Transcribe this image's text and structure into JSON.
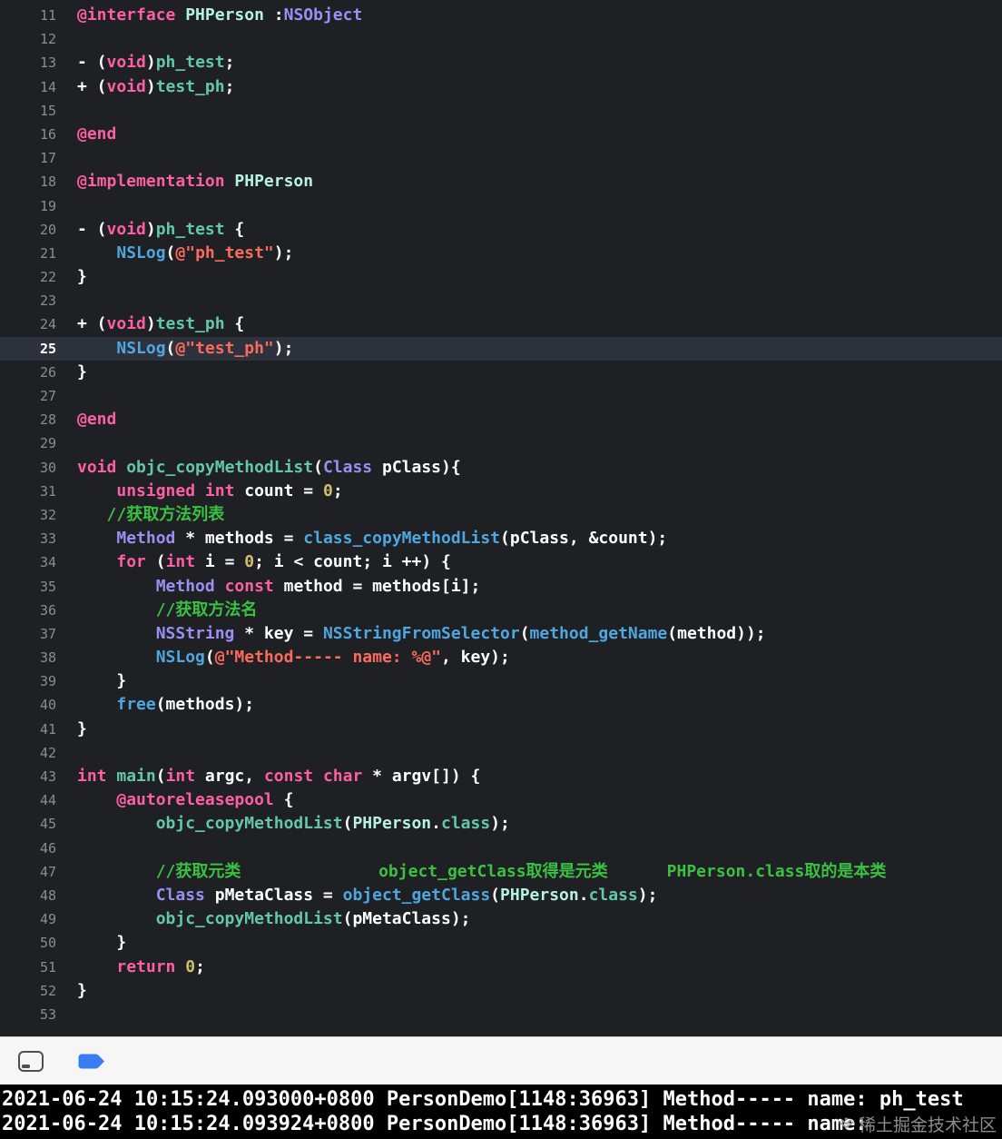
{
  "palette": {
    "editor-bg": "#1e2024",
    "hl-row": "#2e323c",
    "gutter": "#8c8d92",
    "c-kw": "#fc5fa3",
    "c-pl": "#ffffff",
    "c-tc": "#b5f2e1",
    "c-ts": "#9e8df2",
    "c-fn": "#63c7a9",
    "c-fs": "#4ea7e0",
    "c-st": "#fc6a5d",
    "c-nm": "#d0bf69",
    "c-cm": "#3bc142",
    "bar-bg": "#f6f6f6",
    "bar-border": "#c9c9c9",
    "icon-gray": "#4f4f52",
    "breakpoint": "#3a7cf2",
    "console-bg": "#000000",
    "console-fg": "#ffffff",
    "watermark": "#9a9a9a"
  },
  "editor": {
    "highlighted_line": 25,
    "lines": [
      {
        "n": 11,
        "t": [
          [
            "kw",
            "@interface"
          ],
          [
            "pl",
            " "
          ],
          [
            "tc",
            "PHPerson"
          ],
          [
            "pl",
            " :"
          ],
          [
            "ts",
            "NSObject"
          ]
        ]
      },
      {
        "n": 12,
        "t": []
      },
      {
        "n": 13,
        "t": [
          [
            "pl",
            "- ("
          ],
          [
            "kw",
            "void"
          ],
          [
            "pl",
            ")"
          ],
          [
            "fn",
            "ph_test"
          ],
          [
            "pl",
            ";"
          ]
        ]
      },
      {
        "n": 14,
        "t": [
          [
            "pl",
            "+ ("
          ],
          [
            "kw",
            "void"
          ],
          [
            "pl",
            ")"
          ],
          [
            "fn",
            "test_ph"
          ],
          [
            "pl",
            ";"
          ]
        ]
      },
      {
        "n": 15,
        "t": []
      },
      {
        "n": 16,
        "t": [
          [
            "kw",
            "@end"
          ]
        ]
      },
      {
        "n": 17,
        "t": []
      },
      {
        "n": 18,
        "t": [
          [
            "kw",
            "@implementation"
          ],
          [
            "pl",
            " "
          ],
          [
            "tc",
            "PHPerson"
          ]
        ]
      },
      {
        "n": 19,
        "t": []
      },
      {
        "n": 20,
        "t": [
          [
            "pl",
            "- ("
          ],
          [
            "kw",
            "void"
          ],
          [
            "pl",
            ")"
          ],
          [
            "fn",
            "ph_test"
          ],
          [
            "pl",
            " {"
          ]
        ]
      },
      {
        "n": 21,
        "t": [
          [
            "pl",
            "    "
          ],
          [
            "fs",
            "NSLog"
          ],
          [
            "pl",
            "("
          ],
          [
            "st",
            "@\"ph_test\""
          ],
          [
            "pl",
            ");"
          ]
        ]
      },
      {
        "n": 22,
        "t": [
          [
            "pl",
            "}"
          ]
        ]
      },
      {
        "n": 23,
        "t": []
      },
      {
        "n": 24,
        "t": [
          [
            "pl",
            "+ ("
          ],
          [
            "kw",
            "void"
          ],
          [
            "pl",
            ")"
          ],
          [
            "fn",
            "test_ph"
          ],
          [
            "pl",
            " {"
          ]
        ]
      },
      {
        "n": 25,
        "t": [
          [
            "pl",
            "    "
          ],
          [
            "fs",
            "NSLog"
          ],
          [
            "pl",
            "("
          ],
          [
            "st",
            "@\"test_ph\""
          ],
          [
            "pl",
            ");"
          ]
        ]
      },
      {
        "n": 26,
        "t": [
          [
            "pl",
            "}"
          ]
        ]
      },
      {
        "n": 27,
        "t": []
      },
      {
        "n": 28,
        "t": [
          [
            "kw",
            "@end"
          ]
        ]
      },
      {
        "n": 29,
        "t": []
      },
      {
        "n": 30,
        "t": [
          [
            "kw",
            "void"
          ],
          [
            "pl",
            " "
          ],
          [
            "fn",
            "objc_copyMethodList"
          ],
          [
            "pl",
            "("
          ],
          [
            "ts",
            "Class"
          ],
          [
            "pl",
            " pClass){"
          ]
        ]
      },
      {
        "n": 31,
        "t": [
          [
            "pl",
            "    "
          ],
          [
            "kw",
            "unsigned"
          ],
          [
            "pl",
            " "
          ],
          [
            "kw",
            "int"
          ],
          [
            "pl",
            " count = "
          ],
          [
            "nm",
            "0"
          ],
          [
            "pl",
            ";"
          ]
        ]
      },
      {
        "n": 32,
        "t": [
          [
            "pl",
            "   "
          ],
          [
            "cm",
            "//获取方法列表"
          ]
        ]
      },
      {
        "n": 33,
        "t": [
          [
            "pl",
            "    "
          ],
          [
            "ts",
            "Method"
          ],
          [
            "pl",
            " * methods = "
          ],
          [
            "fs",
            "class_copyMethodList"
          ],
          [
            "pl",
            "(pClass, &count);"
          ]
        ]
      },
      {
        "n": 34,
        "t": [
          [
            "pl",
            "    "
          ],
          [
            "kw",
            "for"
          ],
          [
            "pl",
            " ("
          ],
          [
            "kw",
            "int"
          ],
          [
            "pl",
            " i = "
          ],
          [
            "nm",
            "0"
          ],
          [
            "pl",
            "; i < count; i ++) {"
          ]
        ]
      },
      {
        "n": 35,
        "t": [
          [
            "pl",
            "        "
          ],
          [
            "ts",
            "Method"
          ],
          [
            "pl",
            " "
          ],
          [
            "kw",
            "const"
          ],
          [
            "pl",
            " method = methods[i];"
          ]
        ]
      },
      {
        "n": 36,
        "t": [
          [
            "pl",
            "        "
          ],
          [
            "cm",
            "//获取方法名"
          ]
        ]
      },
      {
        "n": 37,
        "t": [
          [
            "pl",
            "        "
          ],
          [
            "ts",
            "NSString"
          ],
          [
            "pl",
            " * key = "
          ],
          [
            "fs",
            "NSStringFromSelector"
          ],
          [
            "pl",
            "("
          ],
          [
            "fs",
            "method_getName"
          ],
          [
            "pl",
            "(method));"
          ]
        ]
      },
      {
        "n": 38,
        "t": [
          [
            "pl",
            "        "
          ],
          [
            "fs",
            "NSLog"
          ],
          [
            "pl",
            "("
          ],
          [
            "st",
            "@\"Method----- name: %@\""
          ],
          [
            "pl",
            ", key);"
          ]
        ]
      },
      {
        "n": 39,
        "t": [
          [
            "pl",
            "    }"
          ]
        ]
      },
      {
        "n": 40,
        "t": [
          [
            "pl",
            "    "
          ],
          [
            "fs",
            "free"
          ],
          [
            "pl",
            "(methods);"
          ]
        ]
      },
      {
        "n": 41,
        "t": [
          [
            "pl",
            "}"
          ]
        ]
      },
      {
        "n": 42,
        "t": []
      },
      {
        "n": 43,
        "t": [
          [
            "kw",
            "int"
          ],
          [
            "pl",
            " "
          ],
          [
            "fn",
            "main"
          ],
          [
            "pl",
            "("
          ],
          [
            "kw",
            "int"
          ],
          [
            "pl",
            " argc, "
          ],
          [
            "kw",
            "const"
          ],
          [
            "pl",
            " "
          ],
          [
            "kw",
            "char"
          ],
          [
            "pl",
            " * argv[]) {"
          ]
        ]
      },
      {
        "n": 44,
        "t": [
          [
            "pl",
            "    "
          ],
          [
            "kw",
            "@autoreleasepool"
          ],
          [
            "pl",
            " {"
          ]
        ]
      },
      {
        "n": 45,
        "t": [
          [
            "pl",
            "        "
          ],
          [
            "fn",
            "objc_copyMethodList"
          ],
          [
            "pl",
            "("
          ],
          [
            "tc",
            "PHPerson"
          ],
          [
            "pl",
            "."
          ],
          [
            "fn",
            "class"
          ],
          [
            "pl",
            ");"
          ]
        ]
      },
      {
        "n": 46,
        "t": []
      },
      {
        "n": 47,
        "t": [
          [
            "pl",
            "        "
          ],
          [
            "cm",
            "//获取元类              object_getClass取得是元类      PHPerson.class取的是本类"
          ]
        ]
      },
      {
        "n": 48,
        "t": [
          [
            "pl",
            "        "
          ],
          [
            "ts",
            "Class"
          ],
          [
            "pl",
            " pMetaClass = "
          ],
          [
            "fs",
            "object_getClass"
          ],
          [
            "pl",
            "("
          ],
          [
            "tc",
            "PHPerson"
          ],
          [
            "pl",
            "."
          ],
          [
            "fn",
            "class"
          ],
          [
            "pl",
            ");"
          ]
        ]
      },
      {
        "n": 49,
        "t": [
          [
            "pl",
            "        "
          ],
          [
            "fn",
            "objc_copyMethodList"
          ],
          [
            "pl",
            "(pMetaClass);"
          ]
        ]
      },
      {
        "n": 50,
        "t": [
          [
            "pl",
            "    }"
          ]
        ]
      },
      {
        "n": 51,
        "t": [
          [
            "pl",
            "    "
          ],
          [
            "kw",
            "return"
          ],
          [
            "pl",
            " "
          ],
          [
            "nm",
            "0"
          ],
          [
            "pl",
            ";"
          ]
        ]
      },
      {
        "n": 52,
        "t": [
          [
            "pl",
            "}"
          ]
        ]
      },
      {
        "n": 53,
        "t": []
      }
    ]
  },
  "console": {
    "lines": [
      "2021-06-24 10:15:24.093000+0800 PersonDemo[1148:36963] Method----- name: ph_test",
      "2021-06-24 10:15:24.093924+0800 PersonDemo[1148:36963] Method----- name:"
    ]
  },
  "watermark": {
    "text": "稀土掘金技术社区"
  }
}
